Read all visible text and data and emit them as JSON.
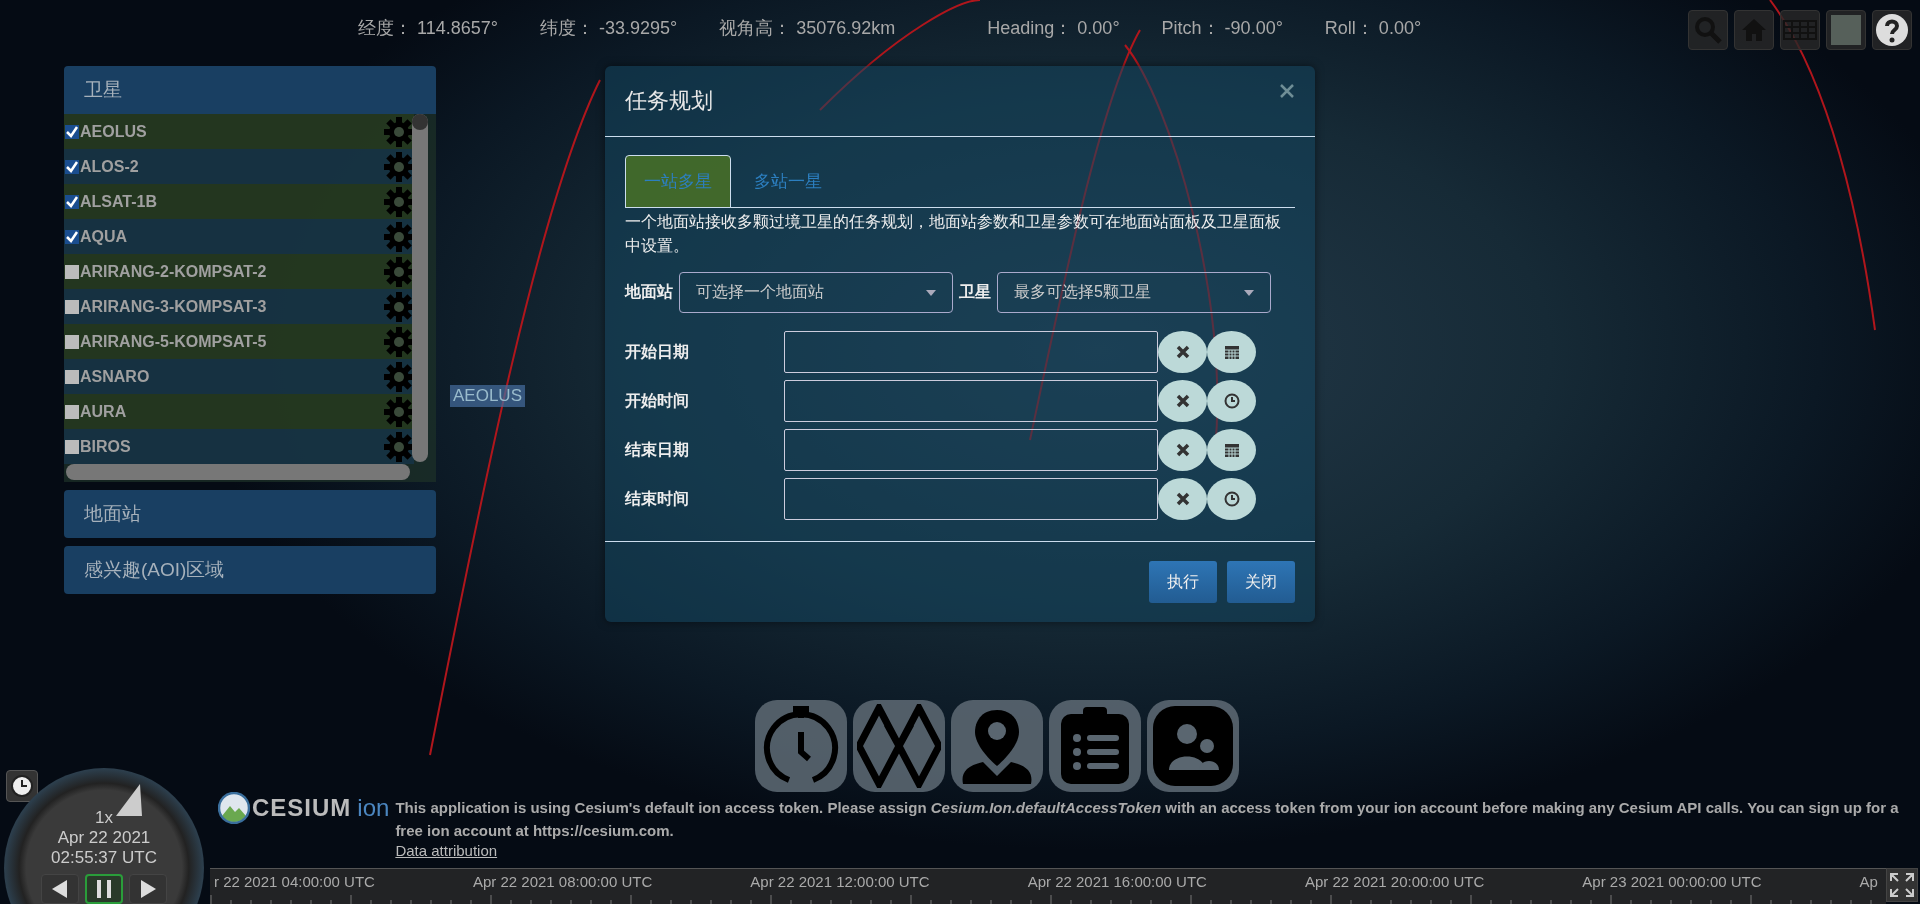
{
  "status_bar": [
    {
      "label": "经度：",
      "value": "114.8657°"
    },
    {
      "label": "纬度：",
      "value": "-33.9295°"
    },
    {
      "label": "视角高：",
      "value": "35076.92km"
    },
    {
      "label": "Heading：",
      "value": "0.00°"
    },
    {
      "label": "Pitch：",
      "value": "-90.00°"
    },
    {
      "label": "Roll：",
      "value": "0.00°"
    }
  ],
  "toolbar": [
    {
      "kind": "search"
    },
    {
      "kind": "home"
    },
    {
      "kind": "grid"
    },
    {
      "kind": "layers"
    },
    {
      "kind": "help"
    }
  ],
  "scene_label": "AEOLUS",
  "sidebar": {
    "sections": [
      {
        "title": "卫星",
        "expanded": true,
        "items": [
          {
            "name": "AEOLUS",
            "checked": true
          },
          {
            "name": "ALOS-2",
            "checked": true
          },
          {
            "name": "ALSAT-1B",
            "checked": true
          },
          {
            "name": "AQUA",
            "checked": true
          },
          {
            "name": "ARIRANG-2-KOMPSAT-2",
            "checked": false
          },
          {
            "name": "ARIRANG-3-KOMPSAT-3",
            "checked": false
          },
          {
            "name": "ARIRANG-5-KOMPSAT-5",
            "checked": false
          },
          {
            "name": "ASNARO",
            "checked": false
          },
          {
            "name": "AURA",
            "checked": false
          },
          {
            "name": "BIROS",
            "checked": false
          }
        ]
      },
      {
        "title": "地面站",
        "expanded": false
      },
      {
        "title": "感兴趣(AOI)区域",
        "expanded": false
      }
    ]
  },
  "dialog": {
    "title": "任务规划",
    "tabs": [
      {
        "label": "一站多星",
        "selected": true
      },
      {
        "label": "多站一星",
        "selected": false
      }
    ],
    "description": "一个地面站接收多颗过境卫星的任务规划，地面站参数和卫星参数可在地面站面板及卫星面板中设置。",
    "selects": [
      {
        "label": "地面站",
        "placeholder": "可选择一个地面站"
      },
      {
        "label": "卫星",
        "placeholder": "最多可选择5颗卫星"
      }
    ],
    "fields": [
      {
        "label": "开始日期",
        "kind": "date"
      },
      {
        "label": "开始时间",
        "kind": "time"
      },
      {
        "label": "结束日期",
        "kind": "date"
      },
      {
        "label": "结束时间",
        "kind": "time"
      }
    ],
    "buttons": [
      "执行",
      "关闭"
    ]
  },
  "dock": [
    {
      "kind": "stopwatch"
    },
    {
      "kind": "diamonds"
    },
    {
      "kind": "pin"
    },
    {
      "kind": "clipboard"
    },
    {
      "kind": "people"
    }
  ],
  "animation": {
    "speed": "1x",
    "date": "Apr 22 2021",
    "time": "02:55:37 UTC",
    "buttons": [
      {
        "kind": "reverse",
        "selected": false
      },
      {
        "kind": "pause",
        "selected": true
      },
      {
        "kind": "forward",
        "selected": false
      }
    ]
  },
  "credit": {
    "brand": "CESIUM",
    "suffix": "ion",
    "message": "This application is using Cesium's default ion access token. Please assign *Cesium.Ion.defaultAccessToken* with an access token from your ion account before making any Cesium API calls. You can sign up for a free ion account at https://cesium.com.",
    "link": "Data attribution"
  },
  "timeline": [
    "r 22 2021 04:00:00 UTC",
    "Apr 22 2021 08:00:00 UTC",
    "Apr 22 2021 12:00:00 UTC",
    "Apr 22 2021 16:00:00 UTC",
    "Apr 22 2021 20:00:00 UTC",
    "Apr 23 2021 00:00:00 UTC",
    "Ap"
  ]
}
